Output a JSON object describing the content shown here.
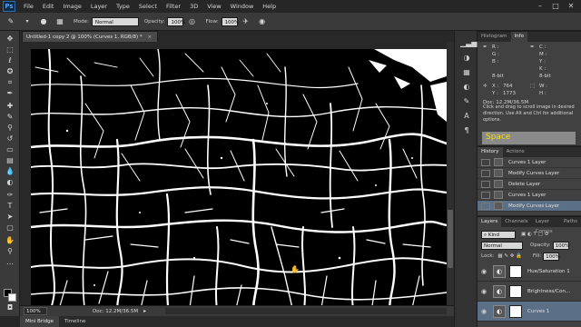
{
  "menubar": {
    "logo": "Ps",
    "items": [
      "File",
      "Edit",
      "Image",
      "Layer",
      "Type",
      "Select",
      "Filter",
      "3D",
      "View",
      "Window",
      "Help"
    ]
  },
  "options": {
    "mode_label": "Mode:",
    "mode_value": "Normal",
    "opacity_label": "Opacity:",
    "opacity_value": "100%",
    "flow_label": "Flow:",
    "flow_value": "100%"
  },
  "document": {
    "tab_title": "Untitled-1 copy 2 @ 100% (Curves 1, RGB/8) *",
    "tab_close": "×"
  },
  "status": {
    "zoom": "100%",
    "doc_info": "Doc: 12.2M/36.5M",
    "arrow": "▸"
  },
  "bottom_tabs": [
    "Mini Bridge",
    "Timeline"
  ],
  "info_panel": {
    "tabs": [
      "Histogram",
      "Info"
    ],
    "rgb_labels": [
      "R :",
      "G :",
      "B :"
    ],
    "bit_depth": "8-bit",
    "x_label": "X :",
    "x_value": "764",
    "y_label": "Y :",
    "y_value": "1773",
    "width_label": "W :",
    "height_label": "H :",
    "doc": "Doc: 12.2M/36.5M",
    "tip": "Click and drag to scroll image in desired direction.  Use Alt and Ctrl for additional options.",
    "overlay_key": "Space"
  },
  "history_panel": {
    "tabs": [
      "History",
      "Actions"
    ],
    "items": [
      {
        "label": "Curves 1 Layer",
        "selected": false
      },
      {
        "label": "Modify Curves Layer",
        "selected": false
      },
      {
        "label": "Delete Layer",
        "selected": false
      },
      {
        "label": "Curves 1 Layer",
        "selected": false
      },
      {
        "label": "Modify Curves Layer",
        "selected": true
      }
    ]
  },
  "layers_panel": {
    "tabs": [
      "Layers",
      "Channels",
      "Layer Comps",
      "Paths"
    ],
    "filter_kind": "Kind",
    "blend_mode": "Normal",
    "opacity_label": "Opacity:",
    "opacity_value": "100%",
    "lock_label": "Lock:",
    "fill_label": "Fill:",
    "fill_value": "100%",
    "layers": [
      {
        "name": "Hue/Saturation 1",
        "selected": false
      },
      {
        "name": "Brightness/Con...",
        "selected": false
      },
      {
        "name": "Curves 1",
        "selected": true
      }
    ]
  }
}
